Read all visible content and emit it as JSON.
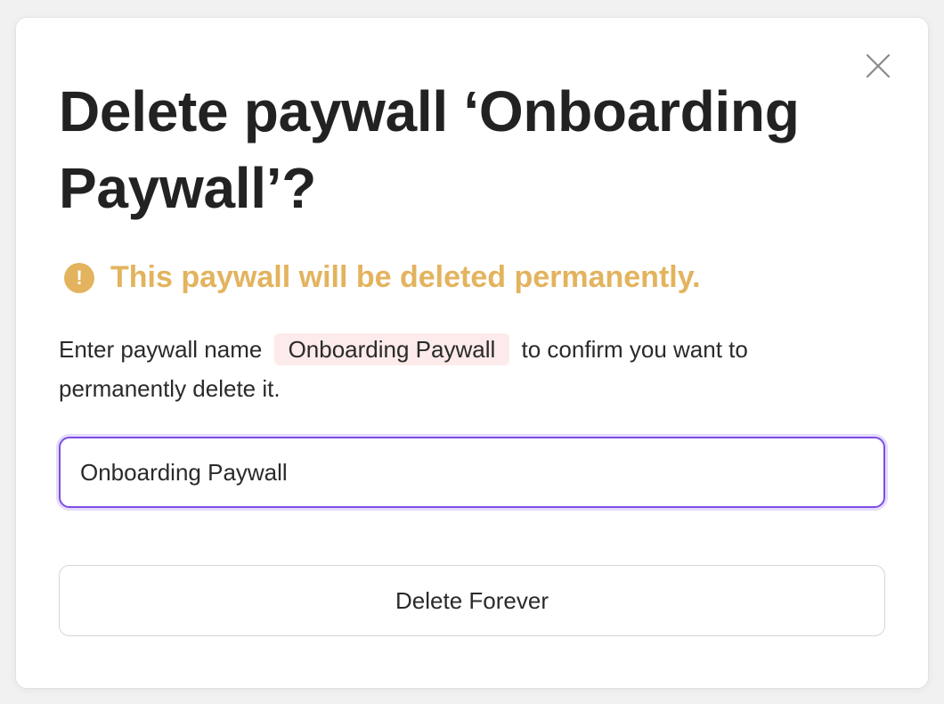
{
  "dialog": {
    "title": "Delete paywall ‘Onboarding Paywall’?",
    "close_icon": "close-icon",
    "warning": {
      "icon": "exclamation-circle-icon",
      "text": "This paywall will be deleted permanently.",
      "color": "#e3b35e"
    },
    "instructions": {
      "prefix": "Enter paywall name",
      "name": "Onboarding Paywall",
      "suffix": "to confirm you want to permanently delete it."
    },
    "input": {
      "value": "Onboarding Paywall",
      "focus_color": "#7c4ee4"
    },
    "delete_button_label": "Delete Forever"
  }
}
